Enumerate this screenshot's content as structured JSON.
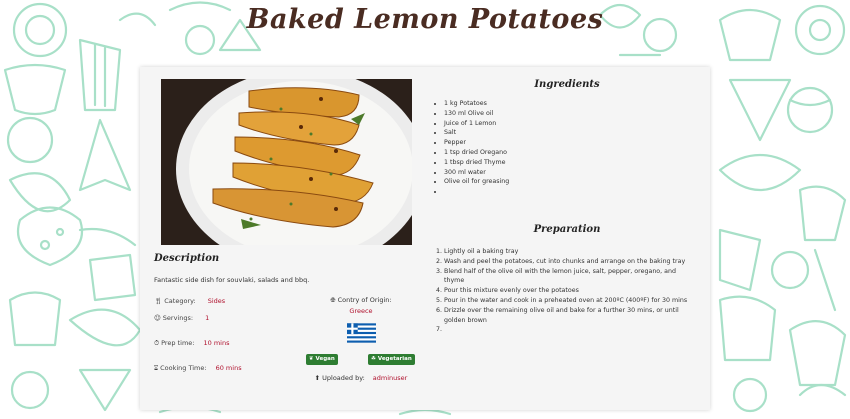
{
  "page": {
    "title": "Baked Lemon Potatoes",
    "colors": {
      "title": "#4a2c22",
      "accent_value": "#b0122e",
      "badge": "#2e7d32",
      "doodle": "#a8e0c8"
    }
  },
  "recipe": {
    "description_heading": "Description",
    "description": "Fantastic side dish for souvlaki, salads and bbq.",
    "category_label": "Category:",
    "category": "Sides",
    "servings_label": "Servings:",
    "servings": "1",
    "prep_label": "Prep time:",
    "prep_time": "10 mins",
    "cook_label": "Cooking Time:",
    "cook_time": "60 mins",
    "origin_label": "Contry of Origin:",
    "origin": "Greece",
    "badges": {
      "vegan": "Vegan",
      "vegetarian": "Vegetarian"
    },
    "uploaded_label": "Uploaded by:",
    "uploaded_by": "adminuser",
    "ingredients_heading": "Ingredients",
    "ingredients": [
      "1 kg Potatoes",
      "130 ml Olive oil",
      "Juice of 1 Lemon",
      "Salt",
      "Pepper",
      "1 tsp dried Oregano",
      "1 tbsp dried Thyme",
      "300 ml water",
      "Olive oil for greasing",
      ""
    ],
    "preparation_heading": "Preparation",
    "steps": [
      "Lightly oil a baking tray",
      "Wash and peel the potatoes, cut into chunks and arrange on the baking tray",
      "Blend half of the olive oil with the lemon juice, salt, pepper, oregano, and thyme",
      "Pour this mixture evenly over the potatoes",
      "Pour in the water and cook in a preheated oven at 200ºC (400ºF) for 30 mins",
      "Drizzle over the remaining olive oil and bake for a further 30 mins, or until golden brown",
      ""
    ]
  }
}
